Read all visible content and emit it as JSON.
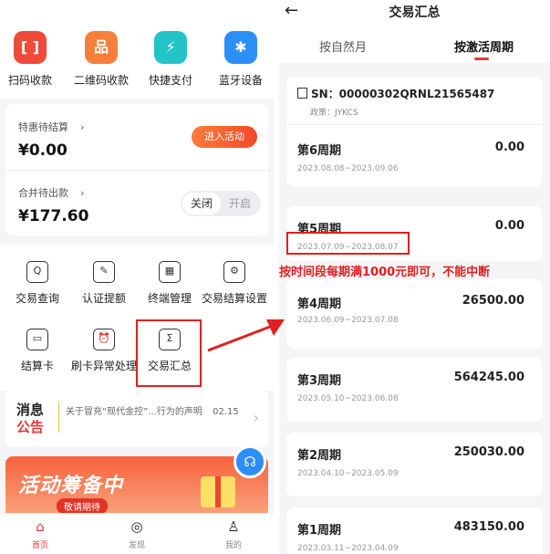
{
  "left": {
    "quick_actions": [
      {
        "label": "扫码收款",
        "icon": "scan-icon",
        "color": "#f04a3a",
        "glyph": "[ ]"
      },
      {
        "label": "二维码收款",
        "icon": "qrcode-icon",
        "color": "#f6803a",
        "glyph": "品"
      },
      {
        "label": "快捷支付",
        "icon": "bolt-icon",
        "color": "#22c4c8",
        "glyph": "⚡"
      },
      {
        "label": "蓝牙设备",
        "icon": "bluetooth-icon",
        "color": "#2b8ff6",
        "glyph": "✱"
      }
    ],
    "pending": {
      "title": "特惠待结算",
      "chevron": "›",
      "amount": "¥0.00",
      "button": "进入活动"
    },
    "merge": {
      "title": "合并待出款",
      "chevron": "›",
      "amount": "¥177.60",
      "toggle_on": "关闭",
      "toggle_off": "开启"
    },
    "functions": [
      {
        "label": "交易查询",
        "icon": "search-doc-icon",
        "glyph": "Q"
      },
      {
        "label": "认证提额",
        "icon": "verify-icon",
        "glyph": "✎"
      },
      {
        "label": "终端管理",
        "icon": "terminal-icon",
        "glyph": "▦"
      },
      {
        "label": "交易结算设置",
        "icon": "settings-icon",
        "glyph": "⚙"
      },
      {
        "label": "结算卡",
        "icon": "card-icon",
        "glyph": "▭"
      },
      {
        "label": "刷卡异常处理",
        "icon": "alarm-icon",
        "glyph": "⏰"
      },
      {
        "label": "交易汇总",
        "icon": "summary-icon",
        "glyph": "Σ"
      }
    ],
    "notice": {
      "logo_top": "消息",
      "logo_bottom": "公告",
      "text": "关于冒充“现代金控”...行为的声明",
      "date": "02.15",
      "arrow": "›"
    },
    "banner": {
      "title": "活动筹备中",
      "subtitle": "敬请期待"
    },
    "tabbar": [
      {
        "label": "首页",
        "icon": "home-icon",
        "glyph": "⌂"
      },
      {
        "label": "发现",
        "icon": "discover-icon",
        "glyph": "◎"
      },
      {
        "label": "我的",
        "icon": "profile-icon",
        "glyph": "♙"
      }
    ]
  },
  "right": {
    "title": "交易汇总",
    "back": "←",
    "tabs": [
      "按自然月",
      "按激活周期"
    ],
    "sn_label": "SN：00000302QRNL21565487",
    "policy": "政策：JYKCS",
    "periods": [
      {
        "name": "第6周期",
        "value": "0.00",
        "date": "2023.08.08~2023.09.06"
      },
      {
        "name": "第5周期",
        "value": "0.00",
        "date": "2023.07.09~2023.08.07"
      },
      {
        "name": "第4周期",
        "value": "26500.00",
        "date": "2023.06.09~2023.07.08"
      },
      {
        "name": "第3周期",
        "value": "564245.00",
        "date": "2023.05.10~2023.06.08"
      },
      {
        "name": "第2周期",
        "value": "250030.00",
        "date": "2023.04.10~2023.05.09"
      },
      {
        "name": "第1周期",
        "value": "483150.00",
        "date": "2023.03.11~2023.04.09"
      }
    ]
  },
  "annotation": "按时间段每期满1000元即可，不能中断",
  "colors": {
    "accent": "#e83838",
    "highlight": "#e02020"
  }
}
